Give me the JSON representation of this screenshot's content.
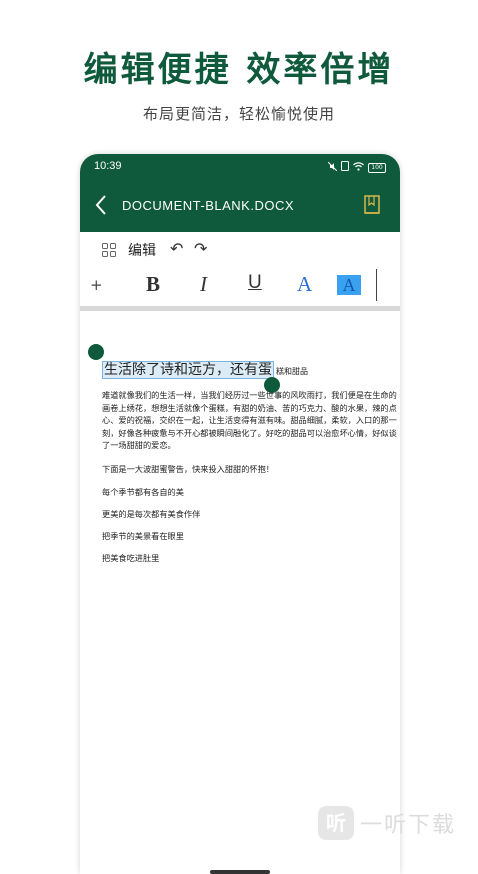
{
  "promo": {
    "headline": "编辑便捷 效率倍增",
    "subline": "布局更简洁，轻松愉悦使用"
  },
  "status_bar": {
    "time": "10:39",
    "battery": "100"
  },
  "app_header": {
    "title": "DOCUMENT-BLANK.DOCX",
    "back_icon": "chevron-left-icon",
    "bookmark_icon": "book-icon",
    "bg_color": "#0f5a3c",
    "bookmark_color": "#d9b84a"
  },
  "toolbar": {
    "edit_label": "编辑",
    "plus": "+",
    "bold": "B",
    "italic": "I",
    "underline": "U",
    "font_color": "A",
    "highlight": "A",
    "undo_glyph": "↶",
    "redo_glyph": "↷"
  },
  "document": {
    "selected_text": "生活除了诗和远方，还有蛋",
    "after_selection": "糕和甜品",
    "paragraph": "难道就像我们的生活一样，当我们经历过一些世事的风吹雨打，我们便是在生命的画卷上绣花，想想生活就像个蛋糕，有甜的奶油、苦的巧克力、酸的水果，辣的点心、爱的祝福，交织在一起，让生活变得有滋有味。甜品细腻，柔软，入口的那一刻，好像各种疲惫与不开心都被瞬间融化了。好吃的甜品可以治愈坏心情，好似谈了一场甜甜的爱恋。",
    "lines": [
      "下面是一大波甜蜜警告，快来投入甜甜的怀抱！",
      "每个季节都有各自的美",
      "更美的是每次都有美食作伴",
      "把季节的美景看在眼里",
      "把美食吃进肚里"
    ]
  },
  "watermark": {
    "logo": "听",
    "text": "一听下载"
  }
}
